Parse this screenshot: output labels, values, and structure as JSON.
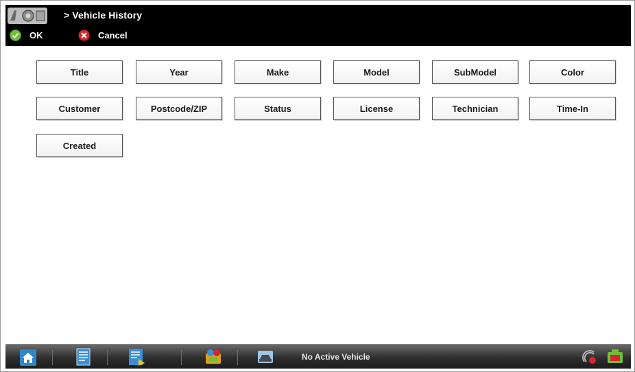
{
  "header": {
    "breadcrumb_prefix": ">",
    "title": "Vehicle History",
    "crumb_icon": "vehicle-scan-icon"
  },
  "toolbar": {
    "ok_label": "OK",
    "ok_icon": "checkmark-icon",
    "cancel_label": "Cancel",
    "cancel_icon": "x-icon"
  },
  "fields": {
    "rows": [
      [
        "Title",
        "Year",
        "Make",
        "Model",
        "SubModel",
        "Color"
      ],
      [
        "Customer",
        "Postcode/ZIP",
        "Status",
        "License",
        "Technician",
        "Time-In"
      ],
      [
        "Created"
      ]
    ]
  },
  "taskbar": {
    "status": "No Active Vehicle",
    "buttons": [
      "home-icon",
      "document-icon",
      "data-list-icon",
      "scanner-icon",
      "vehicle-icon",
      "connection-icon",
      "battery-icon"
    ]
  },
  "colors": {
    "topbar_bg": "#000000",
    "ok_green": "#6fbf3a",
    "cancel_red": "#d8262e",
    "taskbar_bg": "#2e2e2e"
  }
}
